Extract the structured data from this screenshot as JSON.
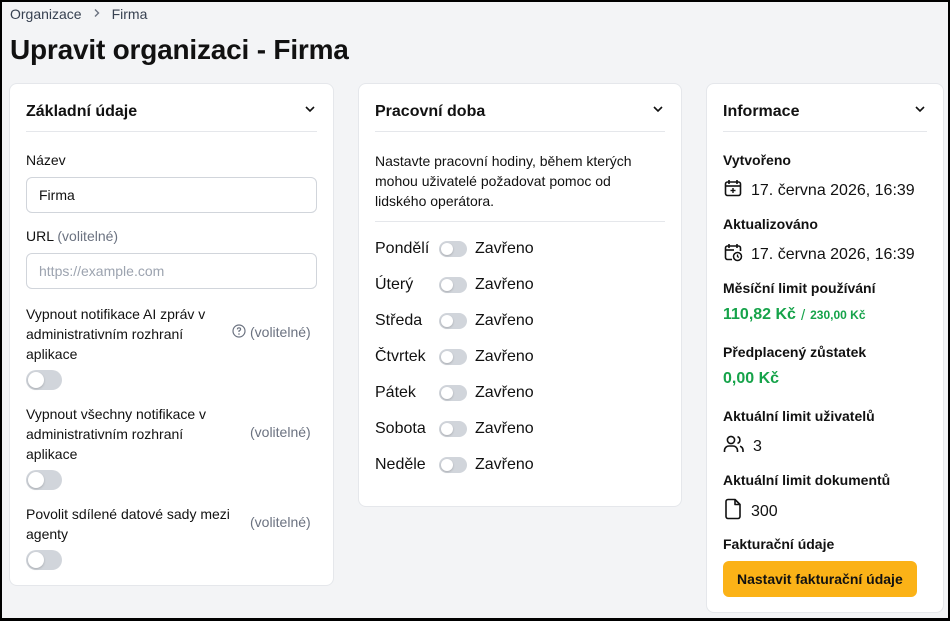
{
  "breadcrumb": {
    "items": [
      "Organizace",
      "Firma"
    ]
  },
  "page": {
    "title": "Upravit organizaci - Firma"
  },
  "basic": {
    "title": "Základní údaje",
    "name_label": "Název",
    "name_value": "Firma",
    "url_label": "URL",
    "url_optional": "(volitelné)",
    "url_placeholder": "https://example.com",
    "ai_notif_label_lines": [
      "Vypnout notifikace AI zpráv v",
      "administrativním rozhraní",
      "aplikace"
    ],
    "ai_notif_optional": "(volitelné)",
    "all_notif_label_lines": [
      "Vypnout všechny notifikace v",
      "administrativním rozhraní",
      "aplikace"
    ],
    "all_notif_optional": "(volitelné)",
    "shared_label_lines": [
      "Povolit sdílené datové sady mezi",
      "agenty"
    ],
    "shared_optional": "(volitelné)"
  },
  "hours": {
    "title": "Pracovní doba",
    "description": "Nastavte pracovní hodiny, během kterých mohou uživatelé požadovat pomoc od lidského operátora.",
    "days": [
      {
        "name": "Pondělí",
        "status": "Zavřeno"
      },
      {
        "name": "Úterý",
        "status": "Zavřeno"
      },
      {
        "name": "Středa",
        "status": "Zavřeno"
      },
      {
        "name": "Čtvrtek",
        "status": "Zavřeno"
      },
      {
        "name": "Pátek",
        "status": "Zavřeno"
      },
      {
        "name": "Sobota",
        "status": "Zavřeno"
      },
      {
        "name": "Neděle",
        "status": "Zavřeno"
      }
    ]
  },
  "info": {
    "title": "Informace",
    "created_label": "Vytvořeno",
    "created_value": "17. června 2026, 16:39",
    "updated_label": "Aktualizováno",
    "updated_value": "17. června 2026, 16:39",
    "monthly_label": "Měsíční limit používání",
    "monthly_used": "110,82 Kč",
    "monthly_sep": "/",
    "monthly_total": "230,00 Kč",
    "prepaid_label": "Předplacený zůstatek",
    "prepaid_value": "0,00 Kč",
    "users_label": "Aktuální limit uživatelů",
    "users_value": "3",
    "docs_label": "Aktuální limit dokumentů",
    "docs_value": "300",
    "billing_label": "Fakturační údaje",
    "billing_button": "Nastavit fakturační údaje"
  },
  "colors": {
    "accent": "#fbb217",
    "green": "#16a34a",
    "toggle_off": "#d1d5db"
  }
}
